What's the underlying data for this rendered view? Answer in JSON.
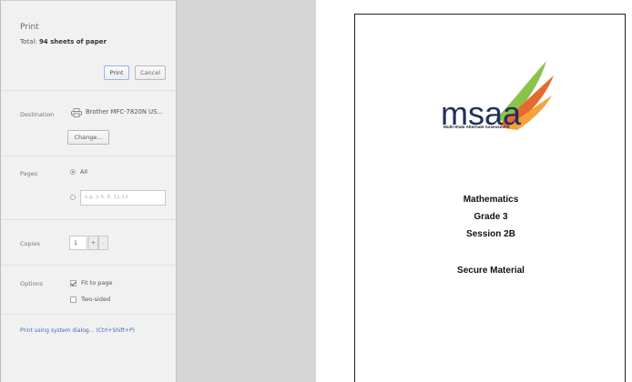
{
  "print_panel": {
    "title": "Print",
    "total_prefix": "Total: ",
    "total_sheets": "94 sheets of paper",
    "print_label": "Print",
    "cancel_label": "Cancel",
    "destination": {
      "label": "Destination",
      "printer_name": "Brother MFC-7820N US...",
      "change_label": "Change..."
    },
    "pages": {
      "label": "Pages",
      "all_label": "All",
      "range_placeholder": "e.g. 1-5, 8, 11-13"
    },
    "copies": {
      "label": "Copies",
      "value": "1",
      "plus": "+",
      "minus": "–"
    },
    "options": {
      "label": "Options",
      "fit_to_page": "Fit to page",
      "two_sided": "Two-sided"
    },
    "system_dialog_link": "Print using system dialog... (Ctrl+Shift+P)"
  },
  "document": {
    "logo_text": "msaa",
    "logo_subtitle": "Multi-State Alternate Assessment",
    "subject": "Mathematics",
    "grade": "Grade 3",
    "session": "Session 2B",
    "secure": "Secure Material"
  },
  "colors": {
    "panel_bg": "#f1f1f1",
    "backdrop_bg": "#d6d6d6",
    "logo_navy": "#1f2f5c",
    "logo_orange": "#e66a2c",
    "logo_green": "#8bc34a",
    "link_blue": "#3c6fb6"
  }
}
